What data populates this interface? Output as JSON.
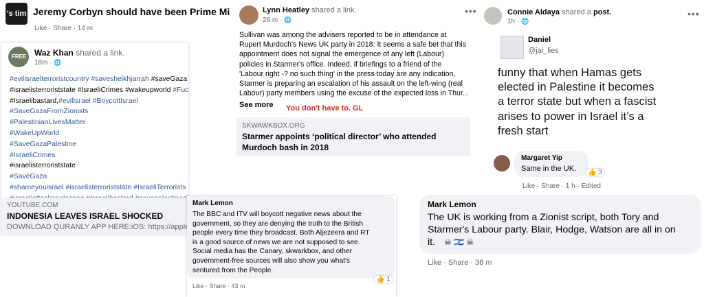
{
  "corbyn_post": {
    "title": "Jeremy Corbyn should have been Prime Minister",
    "avatar_text": "'s tim",
    "actions": "Like · Share · 14 m"
  },
  "waz_post": {
    "author": "Waz Khan",
    "action": "shared a link.",
    "time": "18m ·",
    "avatar_text": "FREE",
    "hashtag_lines": [
      [
        {
          "t": "#evilisraelterroristcountry",
          "k": "link"
        },
        {
          "t": " ",
          "k": "plain"
        },
        {
          "t": "#savesheikhjarrah",
          "k": "link"
        },
        {
          "t": " #saveGaza",
          "k": "plain"
        }
      ],
      [
        {
          "t": "#israelisterroriststate #IsraeliCrimes #wakeupworld ",
          "k": "plain"
        },
        {
          "t": "#FuckIsrael",
          "k": "link"
        }
      ],
      [
        {
          "t": "#Israelibastard,",
          "k": "plain"
        },
        {
          "t": "#evilIsrael",
          "k": "link"
        },
        {
          "t": " ",
          "k": "plain"
        },
        {
          "t": "#BoycottIsrael",
          "k": "link"
        }
      ],
      [
        {
          "t": "#SaveGazaFromZionists",
          "k": "link"
        }
      ],
      [
        {
          "t": "#PalestinianLivesMatter",
          "k": "link"
        }
      ],
      [
        {
          "t": "#WakeUpWorld",
          "k": "link"
        }
      ],
      [
        {
          "t": "#SaveGazaPalestine",
          "k": "link"
        }
      ],
      [
        {
          "t": "#IsraeliCrimes",
          "k": "link"
        }
      ],
      [
        {
          "t": "#israelisterroriststate",
          "k": "plain"
        }
      ],
      [
        {
          "t": "#SaveGaza",
          "k": "link"
        }
      ],
      [
        {
          "t": "#shameyouisrael #israelisterroriststate #IsraeliTerrorists",
          "k": "link"
        }
      ],
      [
        {
          "t": "#israeliattackonalaqsaa #Israelibastard #savepalestinechildren",
          "k": "link"
        }
      ]
    ],
    "link_source": "YOUTUBE.COM",
    "link_title": "INDONESIA LEAVES ISRAEL SHOCKED",
    "link_desc": "DOWNLOAD QURANLY APP HERE:iOS: https://apple."
  },
  "lynn_post": {
    "author": "Lynn Heatley",
    "action": "shared a link.",
    "time": "26 m ·",
    "more_icon": "more-dots-icon",
    "body_lines": [
      "Sullivan was among the advisers reported to be in attendance at",
      "Rupert Murdoch's News UK party in 2018: It seems a safe bet that this",
      "appointment does not signal the emergence of any left (Labour)",
      "policies in Starmer's office. Indeed, if briefings to a friend of the",
      "'Labour right -? no such thing'  in the press today are any indication,",
      "Starmer is preparing an escalation of his assault on the left-wing (real",
      "Labour) party members using the excuse of the expected loss in Thur..."
    ],
    "see_more": "See more",
    "annotation": "You don't have to. GL",
    "link_source": "SKWAWKBOX.ORG",
    "link_title_lines": [
      "Starmer appoints ‘political director’ who attended",
      "Murdoch bash in 2018"
    ]
  },
  "connie_post": {
    "author": "Connie Aldaya",
    "action": "shared a",
    "action_link": "post.",
    "time": "1h ·",
    "more_icon": "more-dots-icon",
    "tweet_name": "Daniel",
    "tweet_handle": "@jai_lies",
    "tweet_lines": [
      "funny that when Hamas gets",
      "elected in Palestine it becomes",
      "a terror state but when a fascist",
      "arises to power in Israel it’s a",
      "fresh start"
    ],
    "comment_author": "Margaret Yip",
    "comment_text": "Same in the UK.",
    "comment_reactions": "3",
    "comment_actions": "Like · Share · 1 h · Edited"
  },
  "mark_comment_1": {
    "author": "Mark Lemon",
    "lines": [
      "The BBC and ITV will boycott negative news about the",
      "government, so they are denying the truth to the British",
      "people every time they broadcast. Both Aljezeera and RT",
      "is a good source of news we are not supposed to see.",
      "Social media has the Canary, skwarkbox, and other",
      "government-free sources will also show you what's",
      "sentured from the People."
    ],
    "reactions": "1",
    "actions": "Like · Share · 43 m"
  },
  "mark_comment_2": {
    "author": "Mark Lemon",
    "lines": [
      "The UK is working from a Zionist script, both Tory and",
      "Starmer's Labour party. Blair, Hodge, Watson are all in on",
      "it."
    ],
    "emoji": "☠ 🇮🇱 ☠",
    "actions": "Like · Share · 38 m"
  },
  "colors": {
    "link_blue": "#385898",
    "grey_text": "#65676b",
    "bubble_bg": "#f0f2f5",
    "annotation_red": "#e0231a",
    "like_blue": "#1877f2"
  }
}
